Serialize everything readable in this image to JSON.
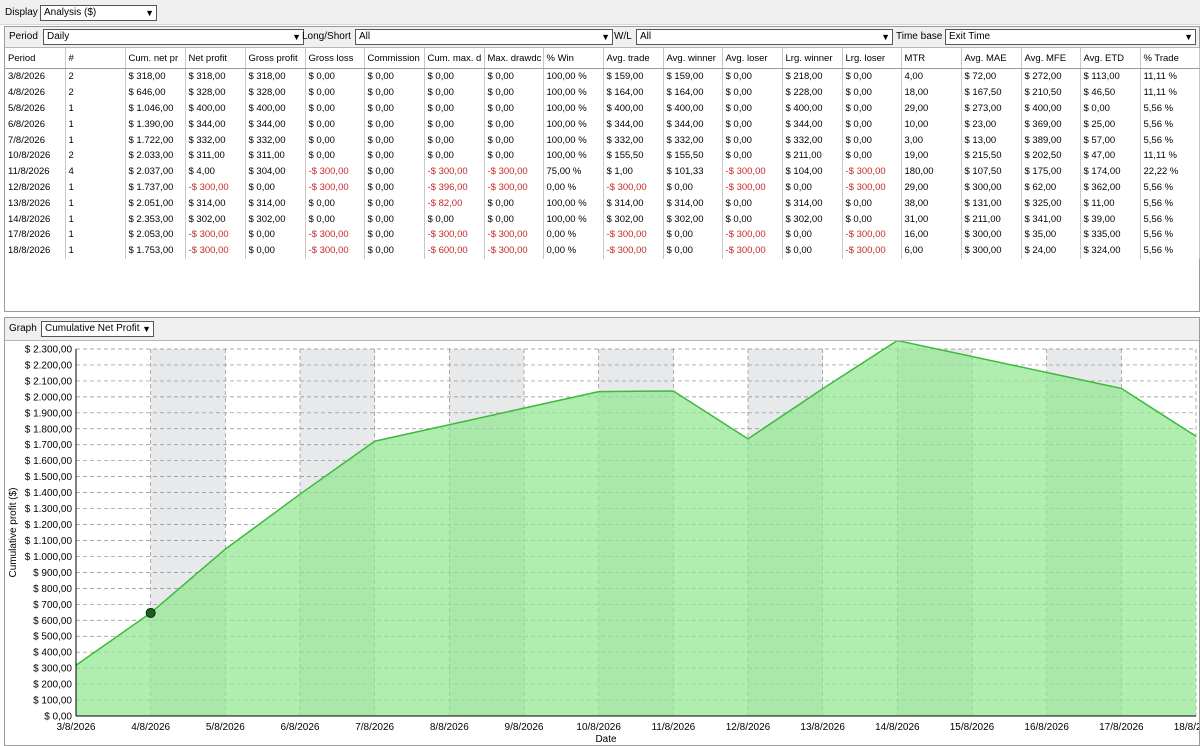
{
  "display": {
    "label": "Display",
    "value": "Analysis ($)"
  },
  "filters": {
    "period": {
      "label": "Period",
      "value": "Daily"
    },
    "long_short": {
      "label": "Long/Short",
      "value": "All"
    },
    "wl": {
      "label": "W/L",
      "value": "All"
    },
    "time_base": {
      "label": "Time base",
      "value": "Exit Time"
    }
  },
  "table": {
    "columns": [
      "Period",
      "#",
      "Cum. net pr",
      "Net profit",
      "Gross profit",
      "Gross loss",
      "Commission",
      "Cum. max. d",
      "Max. drawdc",
      "% Win",
      "Avg. trade",
      "Avg. winner",
      "Avg. loser",
      "Lrg. winner",
      "Lrg. loser",
      "MTR",
      "Avg. MAE",
      "Avg. MFE",
      "Avg. ETD",
      "% Trade"
    ],
    "rows": [
      [
        "3/8/2026",
        "2",
        "$ 318,00",
        "$ 318,00",
        "$ 318,00",
        "$ 0,00",
        "$ 0,00",
        "$ 0,00",
        "$ 0,00",
        "100,00 %",
        "$ 159,00",
        "$ 159,00",
        "$ 0,00",
        "$ 218,00",
        "$ 0,00",
        "4,00",
        "$ 72,00",
        "$ 272,00",
        "$ 113,00",
        "11,11 %"
      ],
      [
        "4/8/2026",
        "2",
        "$ 646,00",
        "$ 328,00",
        "$ 328,00",
        "$ 0,00",
        "$ 0,00",
        "$ 0,00",
        "$ 0,00",
        "100,00 %",
        "$ 164,00",
        "$ 164,00",
        "$ 0,00",
        "$ 228,00",
        "$ 0,00",
        "18,00",
        "$ 167,50",
        "$ 210,50",
        "$ 46,50",
        "11,11 %"
      ],
      [
        "5/8/2026",
        "1",
        "$ 1.046,00",
        "$ 400,00",
        "$ 400,00",
        "$ 0,00",
        "$ 0,00",
        "$ 0,00",
        "$ 0,00",
        "100,00 %",
        "$ 400,00",
        "$ 400,00",
        "$ 0,00",
        "$ 400,00",
        "$ 0,00",
        "29,00",
        "$ 273,00",
        "$ 400,00",
        "$ 0,00",
        "5,56 %"
      ],
      [
        "6/8/2026",
        "1",
        "$ 1.390,00",
        "$ 344,00",
        "$ 344,00",
        "$ 0,00",
        "$ 0,00",
        "$ 0,00",
        "$ 0,00",
        "100,00 %",
        "$ 344,00",
        "$ 344,00",
        "$ 0,00",
        "$ 344,00",
        "$ 0,00",
        "10,00",
        "$ 23,00",
        "$ 369,00",
        "$ 25,00",
        "5,56 %"
      ],
      [
        "7/8/2026",
        "1",
        "$ 1.722,00",
        "$ 332,00",
        "$ 332,00",
        "$ 0,00",
        "$ 0,00",
        "$ 0,00",
        "$ 0,00",
        "100,00 %",
        "$ 332,00",
        "$ 332,00",
        "$ 0,00",
        "$ 332,00",
        "$ 0,00",
        "3,00",
        "$ 13,00",
        "$ 389,00",
        "$ 57,00",
        "5,56 %"
      ],
      [
        "10/8/2026",
        "2",
        "$ 2.033,00",
        "$ 311,00",
        "$ 311,00",
        "$ 0,00",
        "$ 0,00",
        "$ 0,00",
        "$ 0,00",
        "100,00 %",
        "$ 155,50",
        "$ 155,50",
        "$ 0,00",
        "$ 211,00",
        "$ 0,00",
        "19,00",
        "$ 215,50",
        "$ 202,50",
        "$ 47,00",
        "11,11 %"
      ],
      [
        "11/8/2026",
        "4",
        "$ 2.037,00",
        "$ 4,00",
        "$ 304,00",
        "-$ 300,00",
        "$ 0,00",
        "-$ 300,00",
        "-$ 300,00",
        "75,00 %",
        "$ 1,00",
        "$ 101,33",
        "-$ 300,00",
        "$ 104,00",
        "-$ 300,00",
        "180,00",
        "$ 107,50",
        "$ 175,00",
        "$ 174,00",
        "22,22 %"
      ],
      [
        "12/8/2026",
        "1",
        "$ 1.737,00",
        "-$ 300,00",
        "$ 0,00",
        "-$ 300,00",
        "$ 0,00",
        "-$ 396,00",
        "-$ 300,00",
        "0,00 %",
        "-$ 300,00",
        "$ 0,00",
        "-$ 300,00",
        "$ 0,00",
        "-$ 300,00",
        "29,00",
        "$ 300,00",
        "$ 62,00",
        "$ 362,00",
        "5,56 %"
      ],
      [
        "13/8/2026",
        "1",
        "$ 2.051,00",
        "$ 314,00",
        "$ 314,00",
        "$ 0,00",
        "$ 0,00",
        "-$ 82,00",
        "$ 0,00",
        "100,00 %",
        "$ 314,00",
        "$ 314,00",
        "$ 0,00",
        "$ 314,00",
        "$ 0,00",
        "38,00",
        "$ 131,00",
        "$ 325,00",
        "$ 11,00",
        "5,56 %"
      ],
      [
        "14/8/2026",
        "1",
        "$ 2.353,00",
        "$ 302,00",
        "$ 302,00",
        "$ 0,00",
        "$ 0,00",
        "$ 0,00",
        "$ 0,00",
        "100,00 %",
        "$ 302,00",
        "$ 302,00",
        "$ 0,00",
        "$ 302,00",
        "$ 0,00",
        "31,00",
        "$ 211,00",
        "$ 341,00",
        "$ 39,00",
        "5,56 %"
      ],
      [
        "17/8/2026",
        "1",
        "$ 2.053,00",
        "-$ 300,00",
        "$ 0,00",
        "-$ 300,00",
        "$ 0,00",
        "-$ 300,00",
        "-$ 300,00",
        "0,00 %",
        "-$ 300,00",
        "$ 0,00",
        "-$ 300,00",
        "$ 0,00",
        "-$ 300,00",
        "16,00",
        "$ 300,00",
        "$ 35,00",
        "$ 335,00",
        "5,56 %"
      ],
      [
        "18/8/2026",
        "1",
        "$ 1.753,00",
        "-$ 300,00",
        "$ 0,00",
        "-$ 300,00",
        "$ 0,00",
        "-$ 600,00",
        "-$ 300,00",
        "0,00 %",
        "-$ 300,00",
        "$ 0,00",
        "-$ 300,00",
        "$ 0,00",
        "-$ 300,00",
        "6,00",
        "$ 300,00",
        "$ 24,00",
        "$ 324,00",
        "5,56 %"
      ]
    ]
  },
  "graph": {
    "label": "Graph",
    "value": "Cumulative Net Profit"
  },
  "chart_data": {
    "type": "area",
    "xlabel": "Date",
    "ylabel": "Cumulative profit ($)",
    "x": [
      "3/8/2026",
      "4/8/2026",
      "5/8/2026",
      "6/8/2026",
      "7/8/2026",
      "8/8/2026",
      "9/8/2026",
      "10/8/2026",
      "11/8/2026",
      "12/8/2026",
      "13/8/2026",
      "14/8/2026",
      "15/8/2026",
      "16/8/2026",
      "17/8/2026",
      "18/8/2026"
    ],
    "series": [
      {
        "x": [
          "3/8/2026",
          "4/8/2026",
          "5/8/2026",
          "6/8/2026",
          "7/8/2026",
          "10/8/2026",
          "11/8/2026",
          "12/8/2026",
          "13/8/2026",
          "14/8/2026",
          "17/8/2026",
          "18/8/2026"
        ],
        "values": [
          318,
          646,
          1046,
          1390,
          1722,
          2033,
          2037,
          1737,
          2051,
          2353,
          2053,
          1753
        ]
      }
    ],
    "yticks": [
      "$ 0,00",
      "$ 100,00",
      "$ 200,00",
      "$ 300,00",
      "$ 400,00",
      "$ 500,00",
      "$ 600,00",
      "$ 700,00",
      "$ 800,00",
      "$ 900,00",
      "$ 1.000,00",
      "$ 1.100,00",
      "$ 1.200,00",
      "$ 1.300,00",
      "$ 1.400,00",
      "$ 1.500,00",
      "$ 1.600,00",
      "$ 1.700,00",
      "$ 1.800,00",
      "$ 1.900,00",
      "$ 2.000,00",
      "$ 2.100,00",
      "$ 2.200,00",
      "$ 2.300,00"
    ],
    "ylim": [
      0,
      2300
    ],
    "highlight_point": {
      "x": "4/8/2026",
      "y": 646
    },
    "grid": true,
    "fill_color": "#90e890",
    "line_color": "#3cba3c"
  }
}
